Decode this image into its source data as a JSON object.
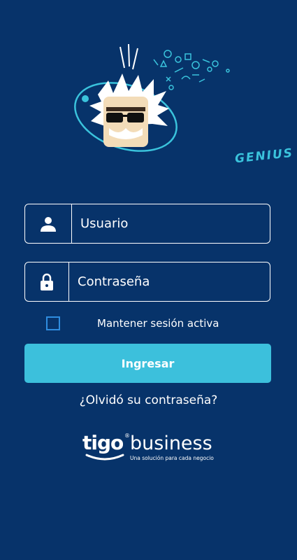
{
  "app": {
    "logo_text": "GENIUS"
  },
  "login": {
    "username_placeholder": "Usuario",
    "password_placeholder": "Contraseña",
    "remember_label": "Mantener sesión activa",
    "remember_checked": false,
    "submit_label": "Ingresar",
    "forgot_label": "¿Olvidó su contraseña?"
  },
  "brand": {
    "name": "tigo",
    "product": "business",
    "registered": "®",
    "tagline": "Una solución para cada negocio"
  },
  "colors": {
    "background": "#07336a",
    "accent": "#3cc0dc",
    "checkbox_border": "#2f8de0",
    "text": "#ffffff"
  },
  "icons": {
    "username": "user-icon",
    "password": "lock-icon",
    "mascot": "genius-mascot-icon"
  }
}
